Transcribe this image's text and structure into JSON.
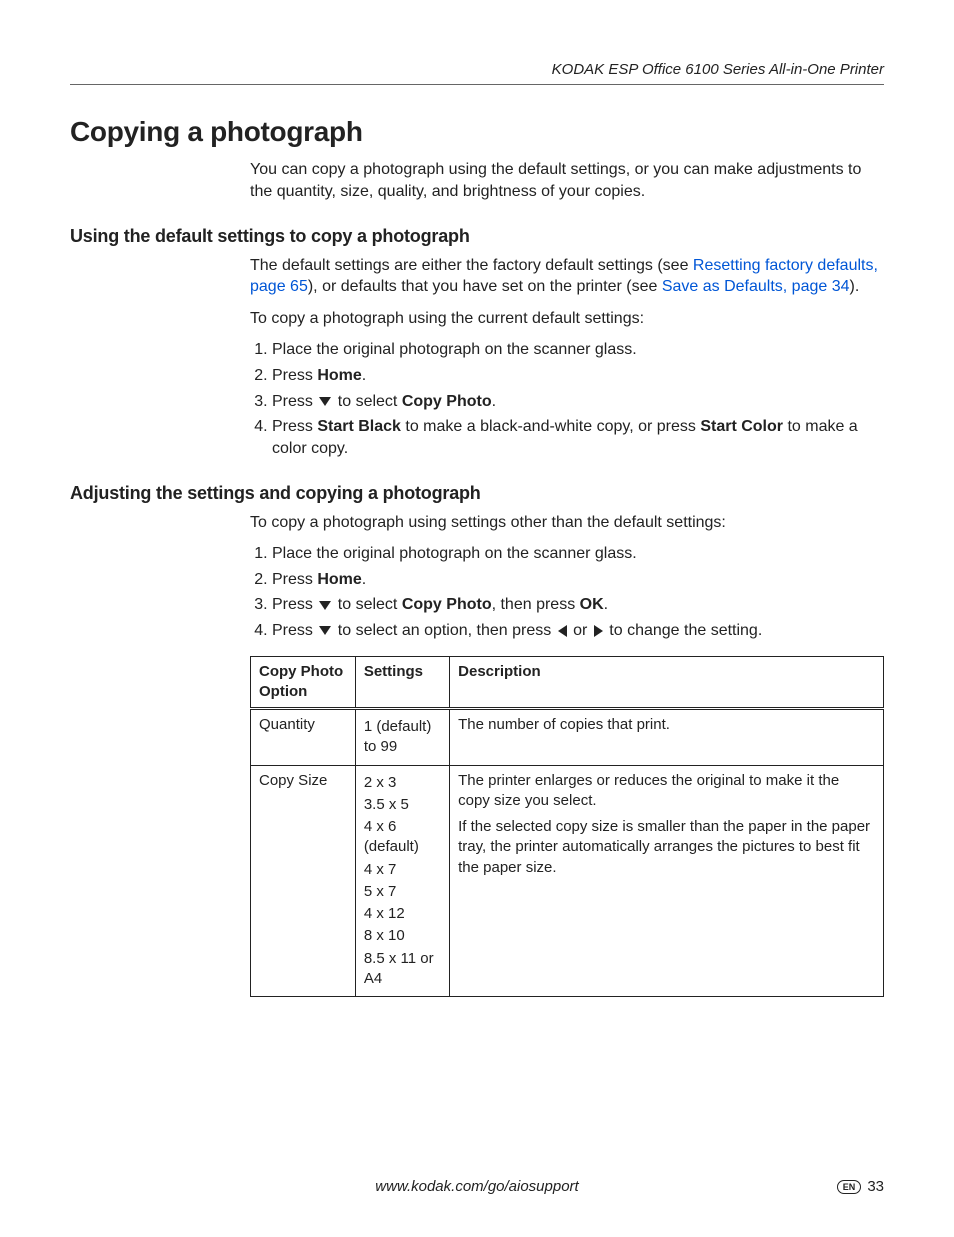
{
  "header": "KODAK ESP Office 6100 Series All-in-One Printer",
  "title": "Copying a photograph",
  "intro": "You can copy a photograph using the default settings, or you can make adjustments to the quantity, size, quality, and brightness of your copies.",
  "section1": {
    "heading": "Using the default settings to copy a photograph",
    "p1_a": "The default settings are either the factory default settings (see ",
    "p1_link1": "Resetting factory defaults, page 65",
    "p1_b": "), or defaults that you have set on the printer (see ",
    "p1_link2": "Save as Defaults, page 34",
    "p1_c": ").",
    "p2": "To copy a photograph using the current default settings:",
    "steps": {
      "s1": "Place the original photograph on the scanner glass.",
      "s2_a": "Press ",
      "s2_b": "Home",
      "s2_c": ".",
      "s3_a": "Press ",
      "s3_b": " to select ",
      "s3_c": "Copy Photo",
      "s3_d": ".",
      "s4_a": "Press ",
      "s4_b": "Start Black",
      "s4_c": " to make a black-and-white copy, or press ",
      "s4_d": "Start Color",
      "s4_e": " to make a color copy."
    }
  },
  "section2": {
    "heading": "Adjusting the settings and copying a photograph",
    "p1": "To copy a photograph using settings other than the default settings:",
    "steps": {
      "s1": "Place the original photograph on the scanner glass.",
      "s2_a": "Press ",
      "s2_b": "Home",
      "s2_c": ".",
      "s3_a": "Press ",
      "s3_b": " to select ",
      "s3_c": "Copy Photo",
      "s3_d": ", then press ",
      "s3_e": "OK",
      "s3_f": ".",
      "s4_a": "Press ",
      "s4_b": " to select an option, then press ",
      "s4_c": " or ",
      "s4_d": " to change the setting."
    }
  },
  "table": {
    "head": {
      "c1": "Copy Photo Option",
      "c2": "Settings",
      "c3": "Description"
    },
    "rows": [
      {
        "option": "Quantity",
        "settings": [
          "1 (default) to 99"
        ],
        "desc": "The number of copies that print."
      },
      {
        "option": "Copy Size",
        "settings": [
          "2 x 3",
          "3.5 x 5",
          "4 x 6 (default)",
          "4 x 7",
          "5 x 7",
          "4 x 12",
          "8 x 10",
          "8.5 x 11 or A4"
        ],
        "desc": "The printer enlarges or reduces the original to make it the copy size you select.\nIf the selected copy size is smaller than the paper in the paper tray, the printer automatically arranges the pictures to best fit the paper size."
      }
    ]
  },
  "footer": {
    "url": "www.kodak.com/go/aiosupport",
    "lang": "EN",
    "page": "33"
  }
}
